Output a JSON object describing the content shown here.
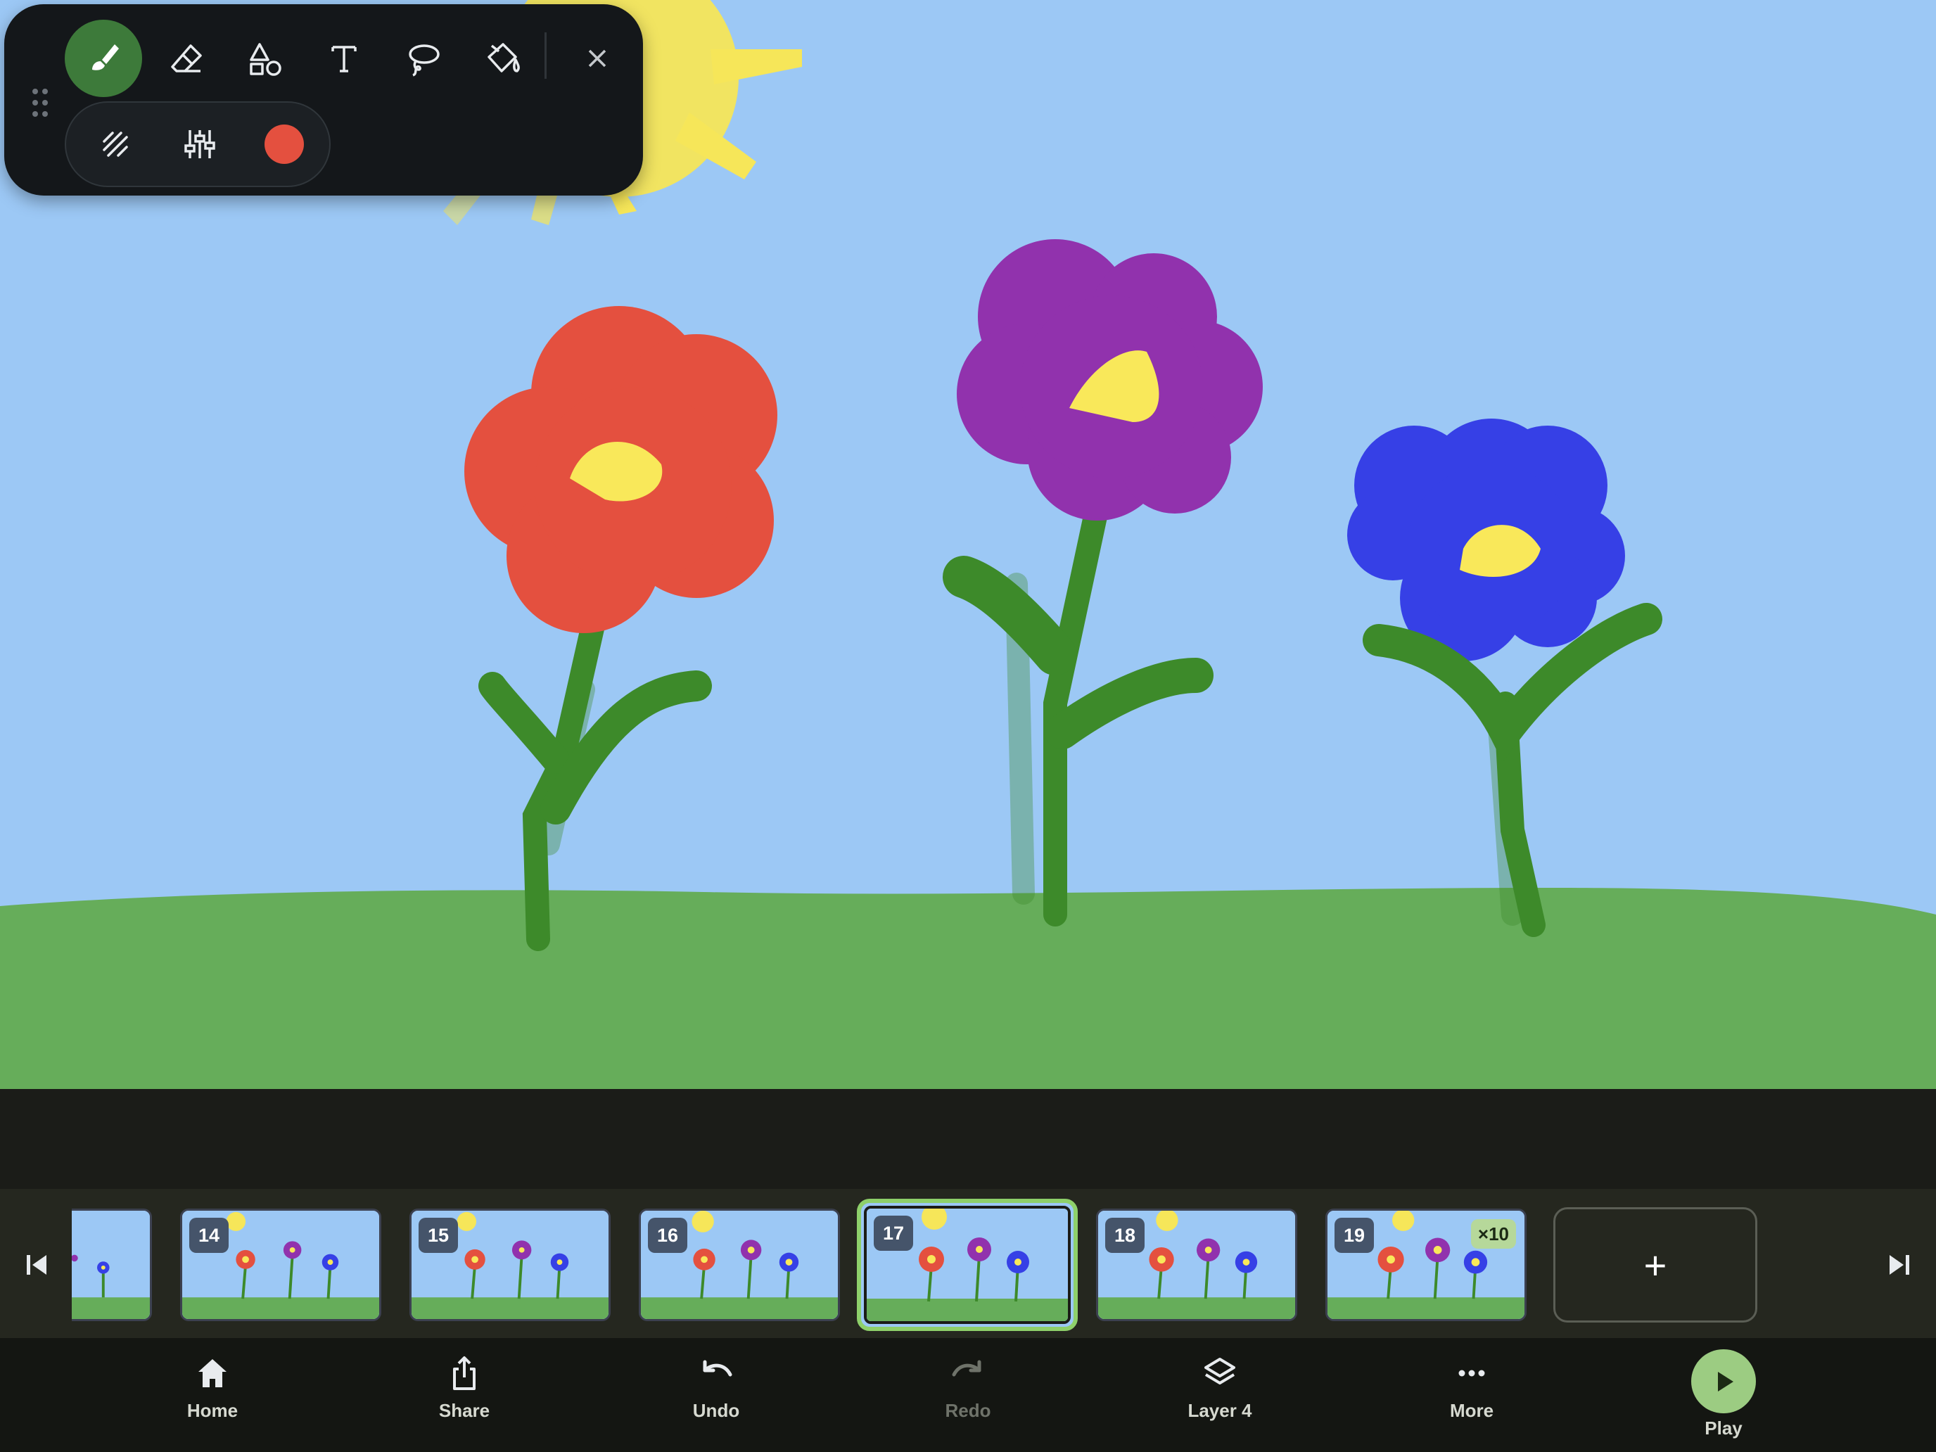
{
  "toolbar": {
    "tools": [
      "brush-icon",
      "eraser-icon",
      "shapes-icon",
      "text-icon",
      "lasso-icon",
      "fill-bucket-icon",
      "close-icon"
    ],
    "active_tool": "brush-icon",
    "sub_tools": [
      "stroke-style-icon",
      "sliders-icon"
    ],
    "current_color": "#e4503f"
  },
  "colors": {
    "sky": "#9cc8f5",
    "grass": "#66ad5a",
    "red_flower": "#e4503f",
    "purple_flower": "#9132ad",
    "blue_flower": "#3640e6",
    "flower_center": "#f9e85a",
    "stem": "#3d8a2a",
    "accent": "#8ed06a"
  },
  "timeline": {
    "frames": [
      {
        "number": "14"
      },
      {
        "number": "15"
      },
      {
        "number": "16"
      },
      {
        "number": "17",
        "selected": true
      },
      {
        "number": "18"
      },
      {
        "number": "19",
        "hold": "×10"
      }
    ],
    "add_label": "+"
  },
  "nav": {
    "home": "Home",
    "share": "Share",
    "undo": "Undo",
    "redo": "Redo",
    "layer": "Layer 4",
    "more": "More",
    "play": "Play"
  }
}
